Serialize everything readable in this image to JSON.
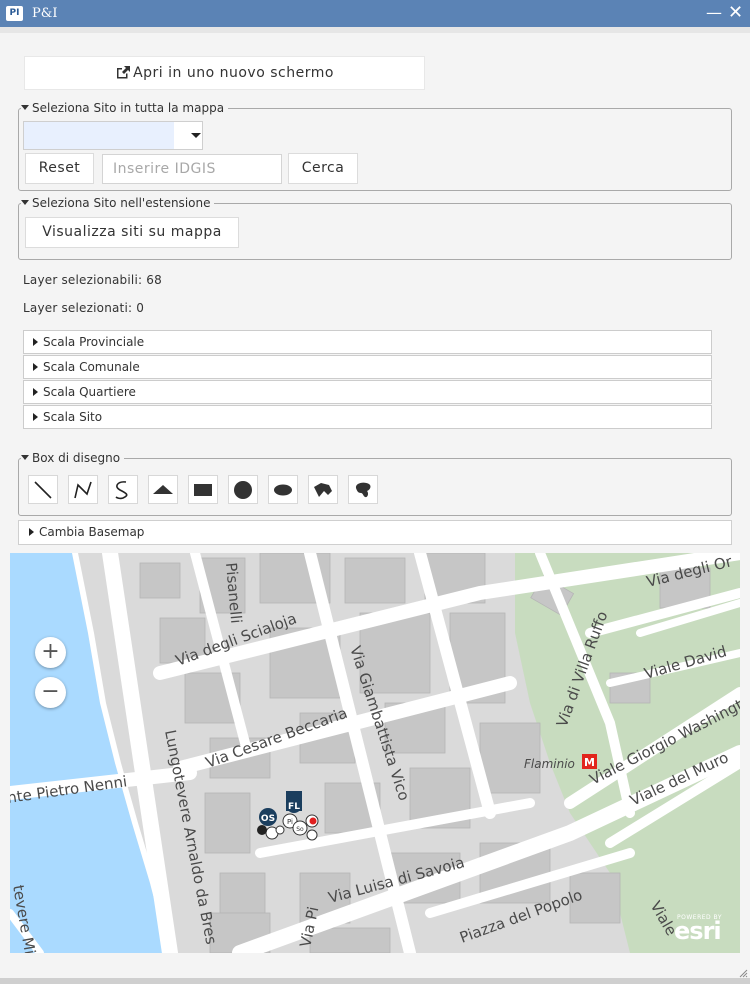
{
  "window": {
    "logo_text": "PI",
    "title": "P&I",
    "minimize_glyph": "—",
    "close_glyph": "✕"
  },
  "open_button": {
    "label": "Apri in uno nuovo schermo",
    "icon": "external-link-icon"
  },
  "site_search": {
    "legend": "Seleziona Sito in tutta la mappa",
    "select_value": "",
    "reset_label": "Reset",
    "idgis_placeholder": "Inserire IDGIS",
    "search_label": "Cerca"
  },
  "extent_search": {
    "legend": "Seleziona Sito nell'estensione",
    "button_label": "Visualizza siti su mappa"
  },
  "layers": {
    "selectable_text": "Layer selezionabili: 68",
    "selected_text": "Layer selezionati: 0"
  },
  "accordion": [
    {
      "label": "Scala Provinciale"
    },
    {
      "label": "Scala Comunale"
    },
    {
      "label": "Scala Quartiere"
    },
    {
      "label": "Scala Sito"
    }
  ],
  "drawing": {
    "legend": "Box di disegno",
    "tools": [
      "line-icon",
      "polyline-icon",
      "freehand-line-icon",
      "triangle-icon",
      "rectangle-icon",
      "circle-icon",
      "ellipse-icon",
      "polygon-icon",
      "freehand-polygon-icon"
    ]
  },
  "basemap": {
    "label": "Cambia Basemap"
  },
  "map": {
    "zoom_in": "+",
    "zoom_out": "−",
    "streets": [
      "Via degli Or",
      "Pisanelli",
      "Via degli Scialoja",
      "Via Giambattista Vico",
      "Via di Villa Ruffo",
      "Viale David",
      "Viale Giorgio Washingto",
      "Via Cesare Beccaria",
      "Lungotevere Arnaldo da Bres",
      "nte Pietro Nenni",
      "Flaminio",
      "Viale del Muro",
      "Via Luisa di Savoia",
      "Piazza del Popolo",
      "Via Pi",
      "tevere Mic",
      "Viale"
    ],
    "metro_symbol": "M",
    "marker_labels": [
      "OS",
      "FL",
      "Pi",
      "So"
    ],
    "attribution_small": "POWERED BY",
    "attribution": "esri",
    "colors": {
      "river": "#aadaff",
      "park": "#c8dcbf",
      "buildings": "#c4c4c4",
      "streets": "#ffffff",
      "base": "#dadada",
      "metro": "#e2251c"
    }
  }
}
